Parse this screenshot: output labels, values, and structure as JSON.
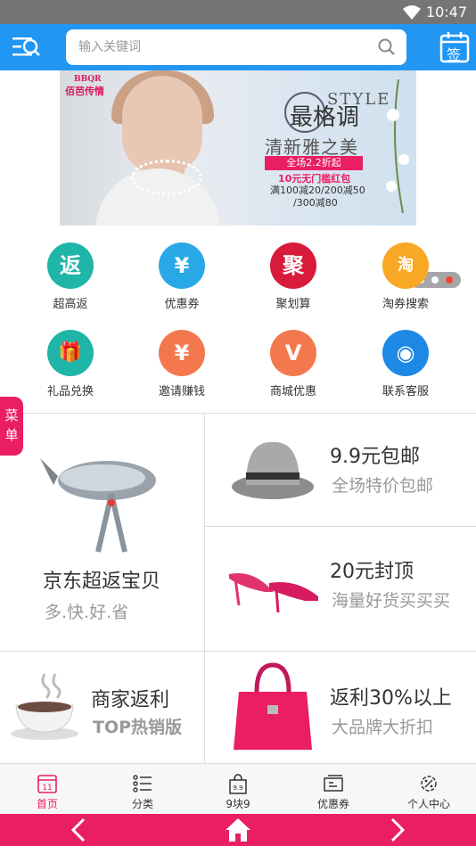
{
  "status": {
    "time": "10:47"
  },
  "search": {
    "placeholder": "输入关键词"
  },
  "header": {
    "checkin_label": "签"
  },
  "banner": {
    "brand_line1": "佰芭传情",
    "brand_line2": "BBQR",
    "title_big": "最格调",
    "title_style": "STYLE",
    "subtitle": "清新雅之美",
    "tag": "全场2.2折起",
    "coupon": "10元无门槛红包",
    "discount1": "满100减20/200减50",
    "discount2": "/300减80",
    "active_dot": 3
  },
  "grid": [
    {
      "label": "超高返",
      "glyph": "返",
      "color": "#1fb5a8"
    },
    {
      "label": "优惠券",
      "glyph": "¥",
      "color": "#29a8e6"
    },
    {
      "label": "聚划算",
      "glyph": "聚",
      "color": "#d81b3a"
    },
    {
      "label": "淘券搜索",
      "glyph": "淘",
      "color": "#f9a825"
    },
    {
      "label": "礼品兑换",
      "glyph": "🎁",
      "color": "#1fb5a8"
    },
    {
      "label": "邀请赚钱",
      "glyph": "¥",
      "color": "#f4784e"
    },
    {
      "label": "商城优惠",
      "glyph": "V",
      "color": "#f4784e"
    },
    {
      "label": "联系客服",
      "glyph": "◉",
      "color": "#1e88e5"
    }
  ],
  "side_menu": {
    "line1": "菜",
    "line2": "单"
  },
  "promos": {
    "jd": {
      "title": "京东超返宝贝",
      "sub": "多.快.好.省"
    },
    "ninenine": {
      "title": "9.9元包邮",
      "sub": "全场特价包邮"
    },
    "twenty": {
      "title": "20元封顶",
      "sub": "海量好货买买买"
    },
    "merchant": {
      "title": "商家返利",
      "sub": "TOP热销版"
    },
    "rebate30": {
      "title": "返利30%以上",
      "sub": "大品牌大折扣"
    }
  },
  "tabs": [
    {
      "label": "首页",
      "active": true
    },
    {
      "label": "分类",
      "active": false
    },
    {
      "label": "9块9",
      "active": false
    },
    {
      "label": "优惠券",
      "active": false
    },
    {
      "label": "个人中心",
      "active": false
    }
  ],
  "tab_icons": {
    "home_day": "11",
    "nine": "9.9"
  },
  "colors": {
    "primary": "#2196f3",
    "accent": "#e91e63"
  }
}
